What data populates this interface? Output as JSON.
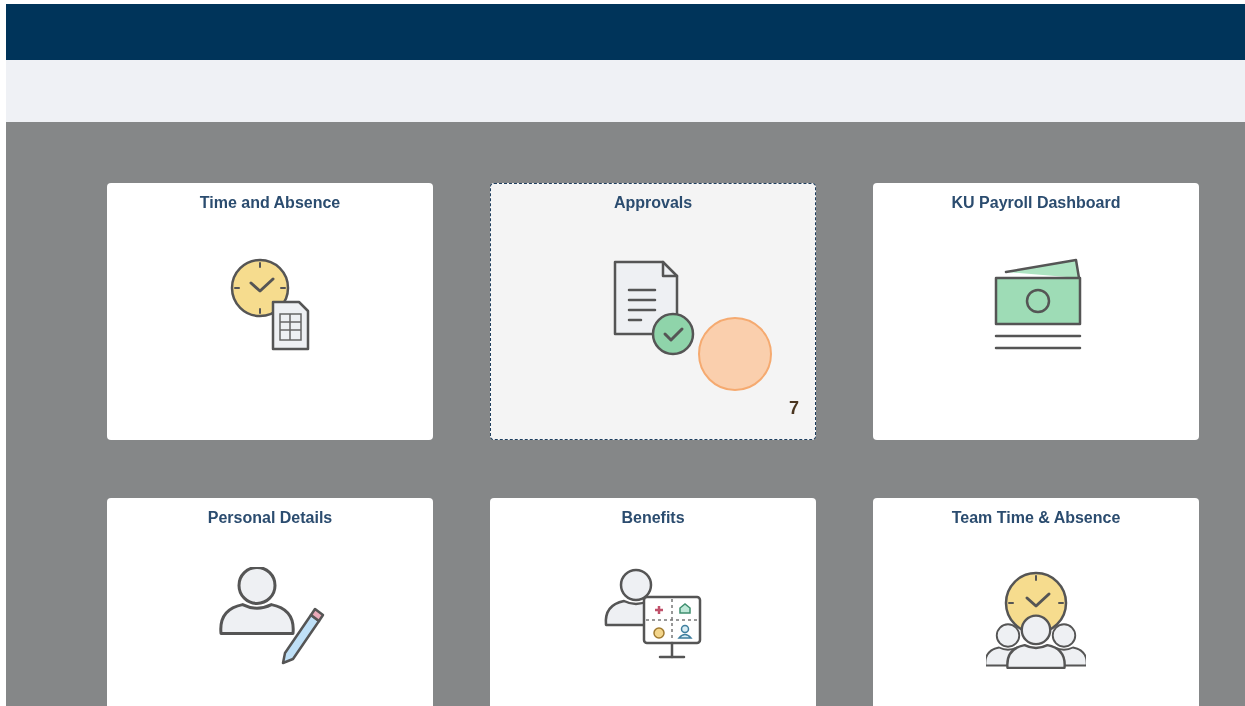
{
  "tiles": [
    {
      "title": "Time and Absence",
      "kind": "clock-sheet",
      "selected": false
    },
    {
      "title": "Approvals",
      "kind": "doc-check",
      "selected": true,
      "badge": "7",
      "click_marker": true
    },
    {
      "title": "KU Payroll Dashboard",
      "kind": "money",
      "selected": false
    },
    {
      "title": "Personal Details",
      "kind": "person-pencil",
      "selected": false
    },
    {
      "title": "Benefits",
      "kind": "person-board",
      "selected": false
    },
    {
      "title": "Team Time & Absence",
      "kind": "clock-team",
      "selected": false
    }
  ]
}
